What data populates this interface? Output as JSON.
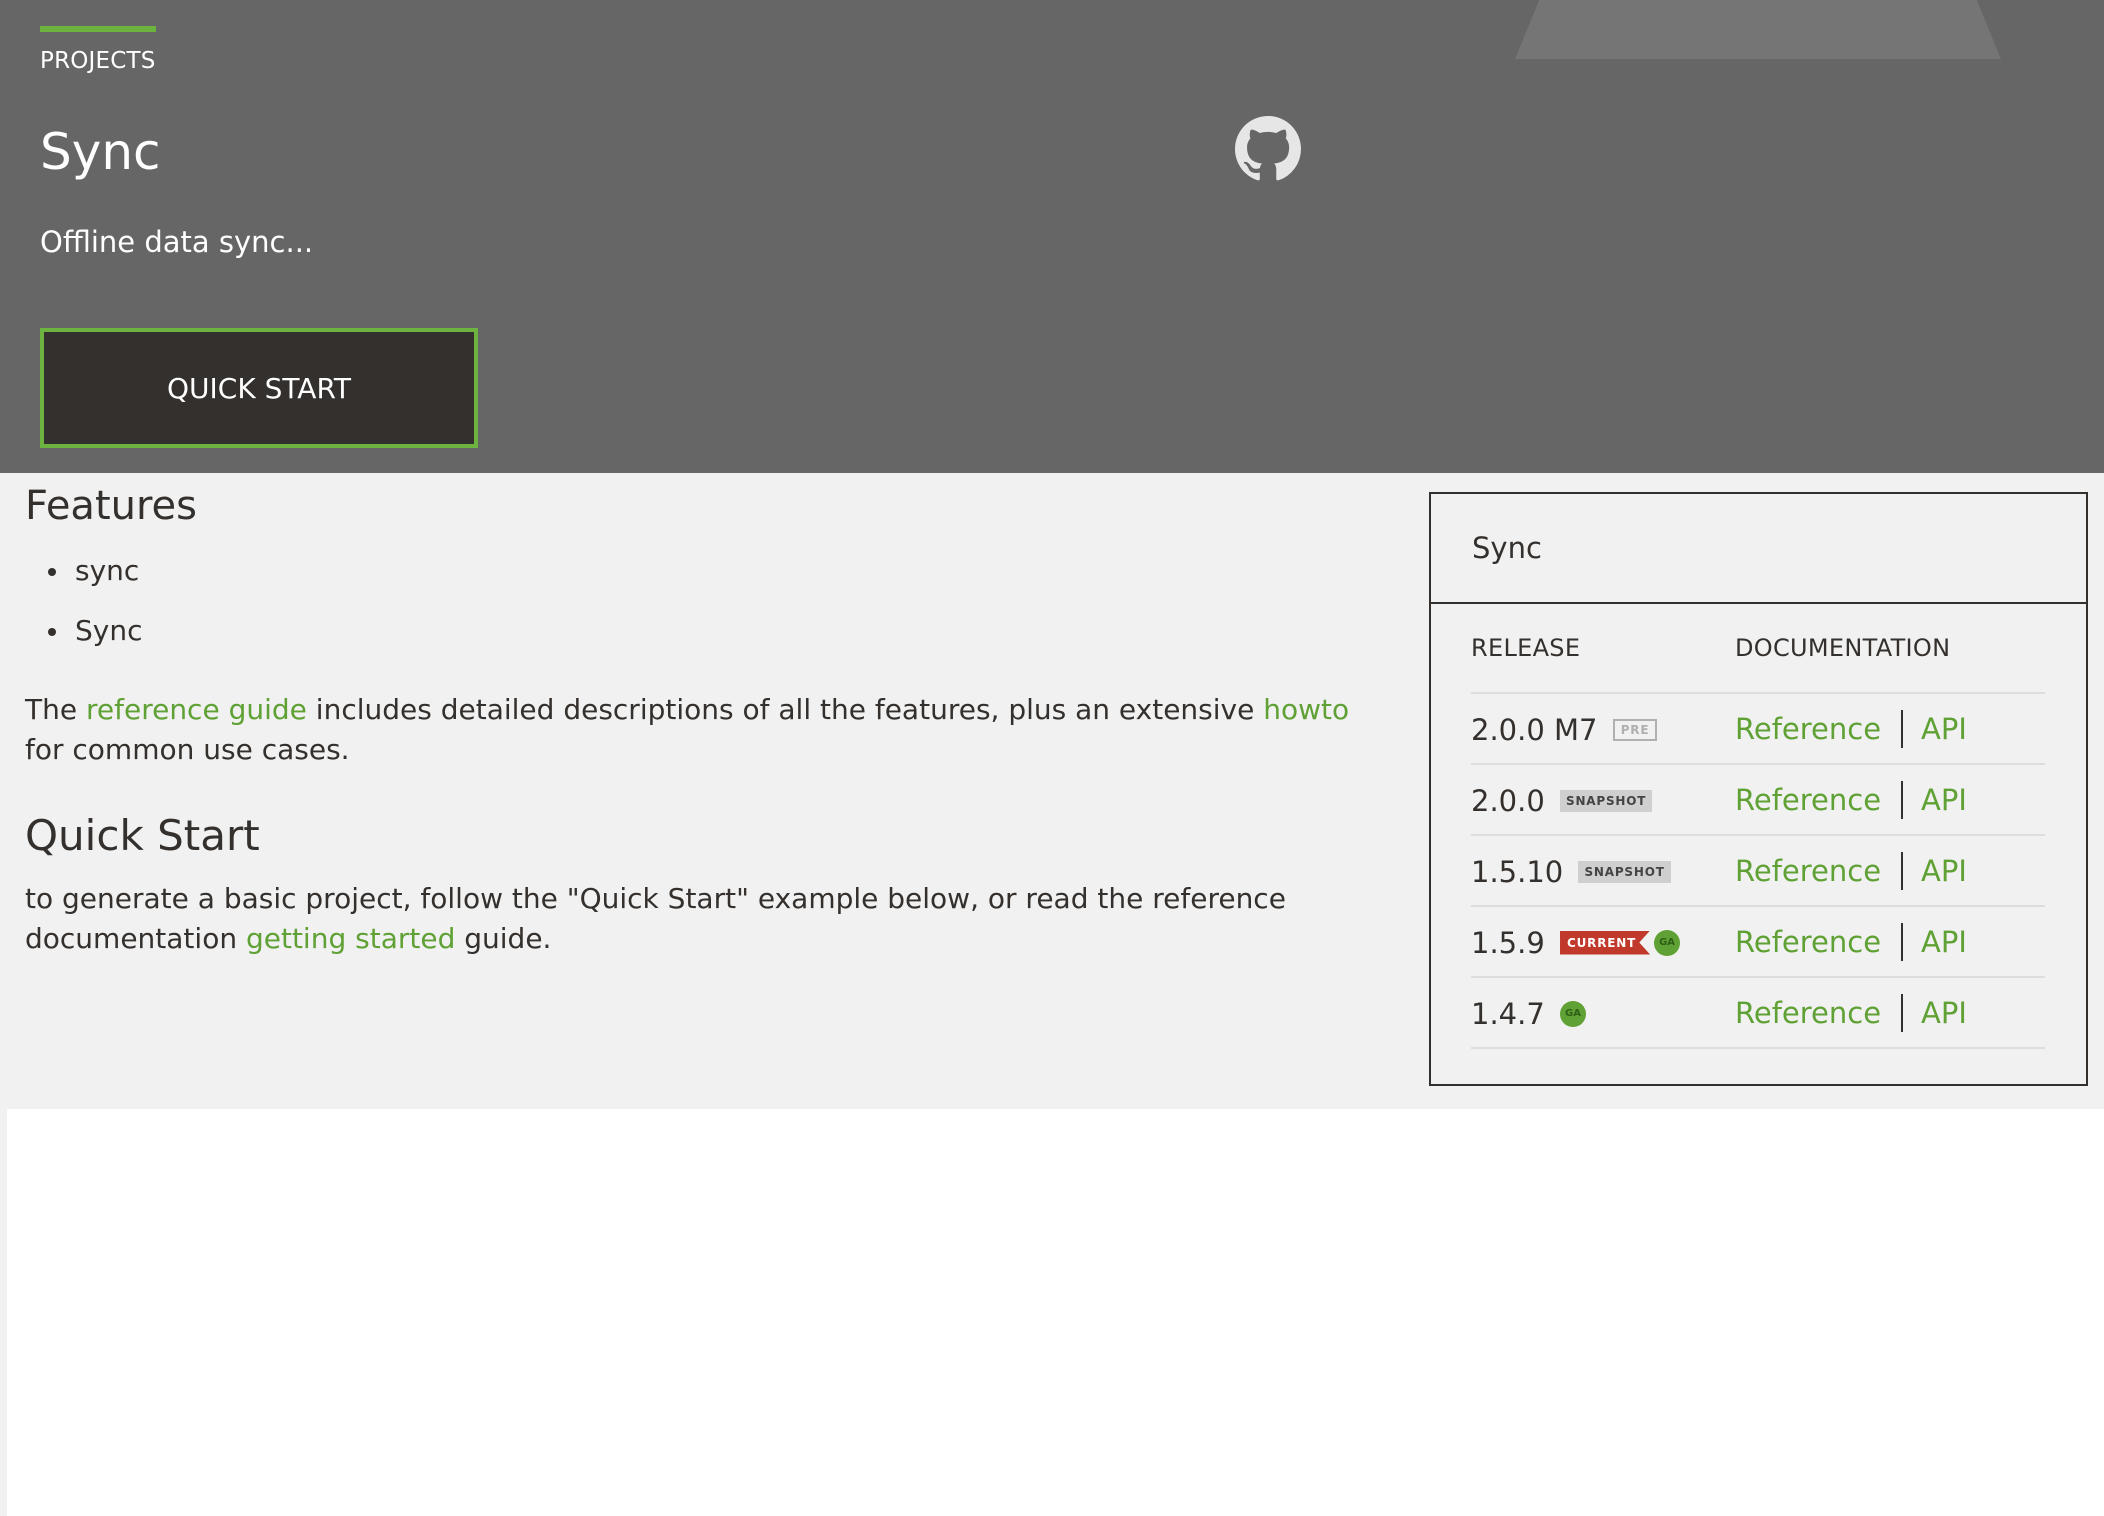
{
  "hero": {
    "projects_label": "PROJECTS",
    "title": "Sync",
    "tagline": "Offline data sync...",
    "quick_start_button": "QUICK START",
    "github_icon": "github-icon"
  },
  "main": {
    "features_heading": "Features",
    "features": [
      "sync",
      "Sync"
    ],
    "reference_paragraph": {
      "before": "The ",
      "link1": "reference guide",
      "middle": " includes detailed descriptions of all the features, plus an extensive ",
      "link2": "howto",
      "after": " for common use cases."
    },
    "quick_start_heading": "Quick Start",
    "quick_start_paragraph": {
      "before": "to generate a basic project, follow the \"Quick Start\" example below, or read the reference documentation ",
      "link": "getting started",
      "after": " guide."
    }
  },
  "releases_panel": {
    "title": "Sync",
    "col_release": "RELEASE",
    "col_documentation": "DOCUMENTATION",
    "rows": [
      {
        "version": "2.0.0 M7",
        "badges": [
          "PRE"
        ],
        "reference": "Reference",
        "api": "API"
      },
      {
        "version": "2.0.0",
        "badges": [
          "SNAPSHOT"
        ],
        "reference": "Reference",
        "api": "API"
      },
      {
        "version": "1.5.10",
        "badges": [
          "SNAPSHOT"
        ],
        "reference": "Reference",
        "api": "API"
      },
      {
        "version": "1.5.9",
        "badges": [
          "CURRENT",
          "GA"
        ],
        "reference": "Reference",
        "api": "API"
      },
      {
        "version": "1.4.7",
        "badges": [
          "GA"
        ],
        "reference": "Reference",
        "api": "API"
      }
    ]
  },
  "colors": {
    "hero_bg": "#666666",
    "accent_green": "#6db33f",
    "link_green": "#5fa134",
    "content_bg": "#f1f1f1",
    "dark": "#34302d",
    "current_badge": "#c0392b"
  }
}
